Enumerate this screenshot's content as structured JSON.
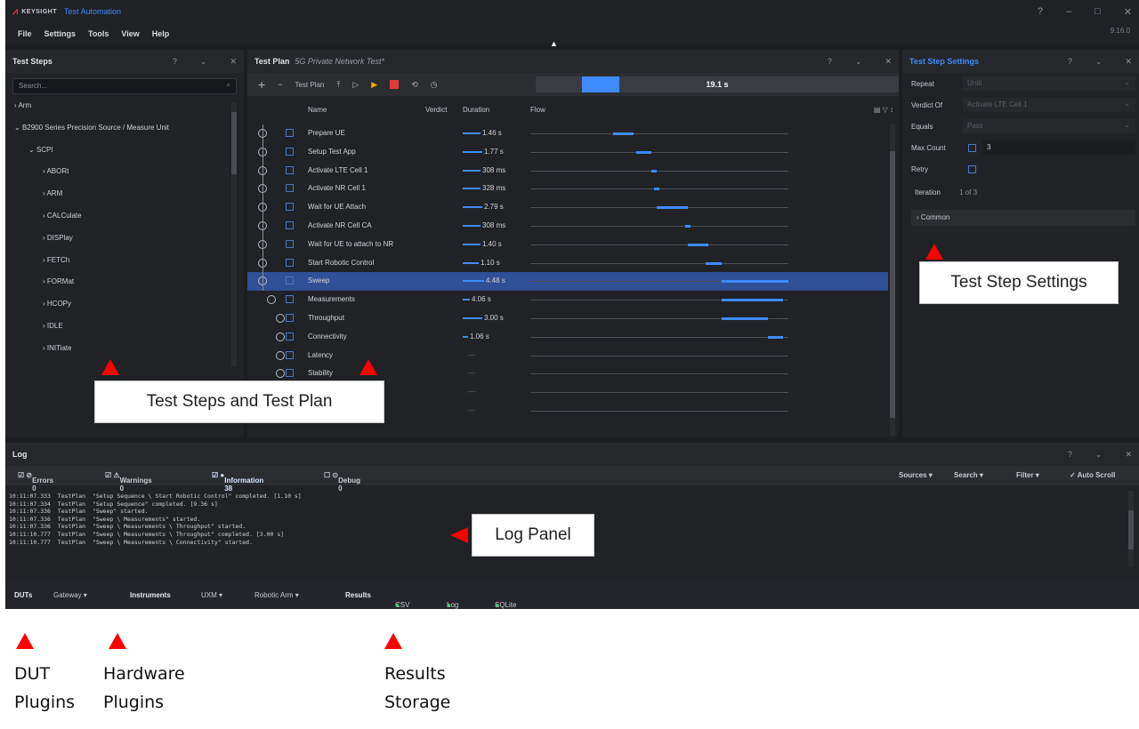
{
  "titlebar": {
    "brand": "KEYSIGHT",
    "app_title": "Test Automation",
    "controls": [
      "?",
      "–",
      "□",
      "✕"
    ]
  },
  "menu": [
    "File",
    "Settings",
    "Tools",
    "View",
    "Help"
  ],
  "version": "9.16.0",
  "test_steps_panel": {
    "title": "Test Steps",
    "search_placeholder": "Search...",
    "tree": [
      {
        "label": "Arm",
        "level": 0,
        "expanded": false
      },
      {
        "label": "B2900 Series Precision Source / Measure Unit",
        "level": 0,
        "expanded": true
      },
      {
        "label": "SCPI",
        "level": 1,
        "expanded": true
      },
      {
        "label": "ABORt",
        "level": 2,
        "expanded": false
      },
      {
        "label": "ARM",
        "level": 2,
        "expanded": false
      },
      {
        "label": "CALCulate",
        "level": 2,
        "expanded": false
      },
      {
        "label": "DISPlay",
        "level": 2,
        "expanded": false
      },
      {
        "label": "FETCh",
        "level": 2,
        "expanded": false
      },
      {
        "label": "FORMat",
        "level": 2,
        "expanded": false
      },
      {
        "label": "HCOPy",
        "level": 2,
        "expanded": false
      },
      {
        "label": "IDLE",
        "level": 2,
        "expanded": false
      },
      {
        "label": "INITiate",
        "level": 2,
        "expanded": false
      }
    ]
  },
  "test_plan_panel": {
    "title": "Test Plan",
    "subtitle": "5G Private Network Test*",
    "toolbar_plan": "Test Plan",
    "progress_fraction": 0.35,
    "elapsed": "19.1 s",
    "columns": [
      "Name",
      "Verdict",
      "Duration",
      "Flow"
    ],
    "steps": [
      {
        "name": "Prepare UE",
        "duration": "1.46 s",
        "dur_frac": 0.5,
        "flow_start": 0.32,
        "flow_len": 0.08,
        "indent": 0,
        "selected": false
      },
      {
        "name": "Setup Test App",
        "duration": "1.77 s",
        "dur_frac": 0.55,
        "flow_start": 0.41,
        "flow_len": 0.06,
        "indent": 0,
        "selected": false
      },
      {
        "name": "Activate LTE Cell 1",
        "duration": "308 ms",
        "dur_frac": 0.5,
        "flow_start": 0.47,
        "flow_len": 0.02,
        "indent": 0,
        "selected": false
      },
      {
        "name": "Activate NR Cell 1",
        "duration": "328 ms",
        "dur_frac": 0.5,
        "flow_start": 0.48,
        "flow_len": 0.02,
        "indent": 0,
        "selected": false
      },
      {
        "name": "Wait for UE Attach",
        "duration": "2.79 s",
        "dur_frac": 0.55,
        "flow_start": 0.49,
        "flow_len": 0.12,
        "indent": 0,
        "selected": false
      },
      {
        "name": "Activate NR Cell CA",
        "duration": "308 ms",
        "dur_frac": 0.5,
        "flow_start": 0.6,
        "flow_len": 0.02,
        "indent": 0,
        "selected": false
      },
      {
        "name": "Wait for UE to attach to NR",
        "duration": "1.40 s",
        "dur_frac": 0.5,
        "flow_start": 0.61,
        "flow_len": 0.08,
        "indent": 0,
        "selected": false
      },
      {
        "name": "Start Robotic Control",
        "duration": "1.10 s",
        "dur_frac": 0.45,
        "flow_start": 0.68,
        "flow_len": 0.06,
        "indent": 0,
        "selected": false
      },
      {
        "name": "Sweep",
        "duration": "4.48 s",
        "dur_frac": 0.6,
        "flow_start": 0.74,
        "flow_len": 0.26,
        "indent": 0,
        "selected": true
      },
      {
        "name": "Measurements",
        "duration": "4.06 s",
        "dur_frac": 0.2,
        "flow_start": 0.74,
        "flow_len": 0.24,
        "indent": 1,
        "selected": false
      },
      {
        "name": "Throughput",
        "duration": "3.00 s",
        "dur_frac": 0.55,
        "flow_start": 0.74,
        "flow_len": 0.18,
        "indent": 2,
        "selected": false
      },
      {
        "name": "Connectivity",
        "duration": "1.06 s",
        "dur_frac": 0.15,
        "flow_start": 0.92,
        "flow_len": 0.06,
        "indent": 2,
        "selected": false
      },
      {
        "name": "Latency",
        "duration": "—",
        "dur_frac": 0,
        "flow_start": 0,
        "flow_len": 0,
        "indent": 2,
        "selected": false
      },
      {
        "name": "Stability",
        "duration": "—",
        "dur_frac": 0,
        "flow_start": 0,
        "flow_len": 0,
        "indent": 2,
        "selected": false
      },
      {
        "name": "",
        "duration": "—",
        "dur_frac": 0,
        "flow_start": 0,
        "flow_len": 0,
        "indent": 0,
        "selected": false
      },
      {
        "name": "",
        "duration": "—",
        "dur_frac": 0,
        "flow_start": 0,
        "flow_len": 0,
        "indent": 0,
        "selected": false
      }
    ]
  },
  "settings_panel": {
    "title": "Test Step Settings",
    "repeat_label": "Repeat",
    "repeat_value": "Until",
    "verdict_label": "Verdict Of",
    "verdict_value": "Activate LTE Cell 1",
    "equals_label": "Equals",
    "equals_value": "Pass",
    "maxcount_label": "Max Count",
    "maxcount_value": "3",
    "retry_label": "Retry",
    "iteration_label": "Iteration",
    "iteration_value": "1 of 3",
    "common_label": "Common"
  },
  "log_panel": {
    "title": "Log",
    "filters": [
      "Errors 0",
      "Warnings 0",
      "Information 38",
      "Debug 0"
    ],
    "right_tools": [
      "Sources ▾",
      "Search ▾",
      "Filter ▾",
      "✓ Auto Scroll"
    ],
    "lines": [
      "10:11:07.333  TestPlan  \"Setup Sequence \\ Start Robotic Control\" completed. [1.10 s]",
      "10:11:07.334  TestPlan  \"Setup Sequence\" completed. [9.36 s]",
      "10:11:07.336  TestPlan  \"Sweep\" started.",
      "10:11:07.336  TestPlan  \"Sweep \\ Measurements\" started.",
      "10:11:07.336  TestPlan  \"Sweep \\ Measurements \\ Throughput\" started.",
      "10:11:10.777  TestPlan  \"Sweep \\ Measurements \\ Throughput\" completed. [3.00 s]",
      "10:11:10.777  TestPlan  \"Sweep \\ Measurements \\ Connectivity\" started."
    ]
  },
  "statusbar": {
    "duts_label": "DUTs",
    "duts": "Gateway ▾",
    "instr_label": "Instruments",
    "instr": [
      "UXM ▾",
      "Robotic Arm ▾"
    ],
    "results_label": "Results",
    "results": [
      "CSV",
      "Log",
      "SQLite"
    ]
  },
  "callouts": {
    "steps_plan": "Test Steps and Test Plan",
    "settings": "Test Step Settings",
    "log": "Log Panel"
  },
  "captions": {
    "dut": [
      "DUT",
      "Plugins"
    ],
    "hw": [
      "Hardware",
      "Plugins"
    ],
    "results": [
      "Results",
      "Storage"
    ]
  },
  "colors": {
    "accent": "#3d8bff",
    "annotation": "#ff0000",
    "background": "#1b1d21"
  }
}
